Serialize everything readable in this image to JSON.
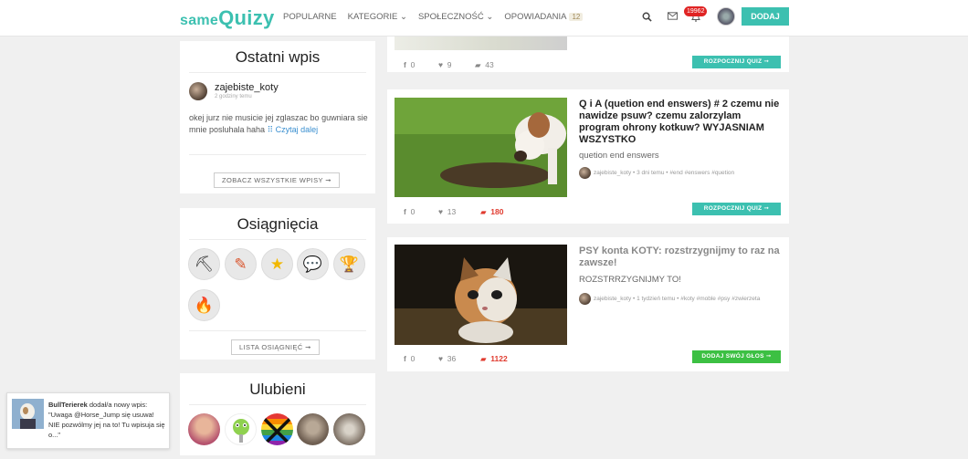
{
  "header": {
    "logo_small": "same",
    "logo_big": "Quizy",
    "nav": [
      {
        "label": "POPULARNE"
      },
      {
        "label": "KATEGORIE ⌄"
      },
      {
        "label": "SPOŁECZNOŚĆ ⌄"
      },
      {
        "label": "OPOWIADANIA"
      }
    ],
    "stories_count": "12",
    "notifications_count": "19962",
    "add_label": "DODAJ",
    "accent": "#3cc0b0"
  },
  "last_post": {
    "title": "Ostatni wpis",
    "author": "zajebiste_koty",
    "time": "2 godziny temu",
    "text": "okej jurz nie musicie jej zglaszac bo guwniara sie mnie posluhala haha ",
    "read_more": "Czytaj dalej",
    "all_posts": "ZOBACZ WSZYSTKIE WPISY ➞"
  },
  "achievements": {
    "title": "Osiągnięcia",
    "icons": [
      "pickaxe-icon",
      "pencil-icon",
      "star-icon",
      "chat-icon",
      "trophy-icon",
      "fire-icon"
    ],
    "list_btn": "LISTA OSIĄGNIĘĆ ➞"
  },
  "favorites": {
    "title": "Ulubieni"
  },
  "cards": [
    {
      "likes": "0",
      "hearts": "9",
      "comments": "43",
      "button": "ROZPOCZNIJ QUIZ ➞"
    },
    {
      "title": "Q i A (quetion end enswers) # 2 czemu nie nawidze psuw? czemu zalorzylam program ohrony kotkuw? WYJASNIAM WSZYSTKO",
      "desc": "quetion end enswers",
      "meta": "zajebiste_koty • 3 dni temu • #end #enswers #quetion",
      "likes": "0",
      "hearts": "13",
      "comments": "180",
      "button": "ROZPOCZNIJ QUIZ ➞"
    },
    {
      "title": "PSY konta KOTY: rozstrzygnijmy to raz na zawsze!",
      "desc": "ROZSTRRZYGNIJMY TO!",
      "meta": "zajebiste_koty • 1 tydzień temu • #koty #moble #psy #zwierzeta",
      "likes": "0",
      "hearts": "36",
      "comments": "1122",
      "button": "DODAJ SWÓJ GŁOS ➞"
    }
  ],
  "toast": {
    "user": "BullTerierek",
    "action": " dodał/a nowy wpis:",
    "quote": "\"Uwaga @Horse_Jump się usuwa! NIE pozwólmy jej na to! Tu wpisuja się o...\""
  }
}
